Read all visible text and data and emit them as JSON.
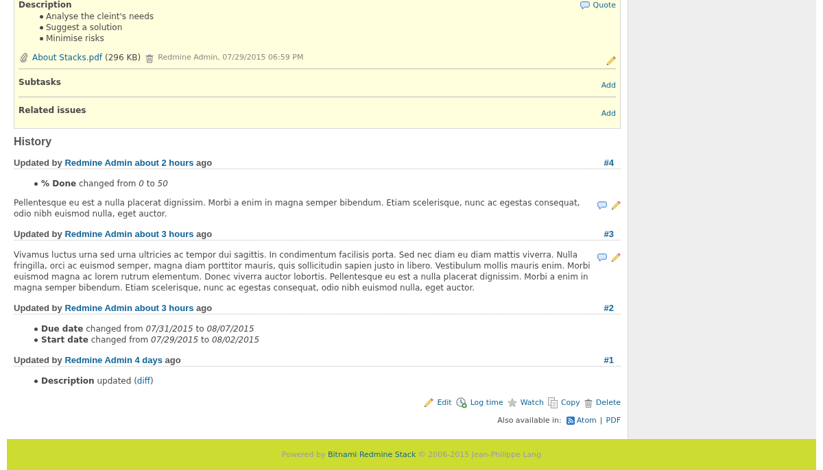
{
  "issue": {
    "description": {
      "label": "Description",
      "quote_link": "Quote",
      "items": [
        "Analyse the cleint's needs",
        "Suggest a solution",
        "Minimise risks"
      ]
    },
    "attachments": [
      {
        "name": "About Stacks.pdf",
        "size": "(296 KB)",
        "author_date": "Redmine Admin, 07/29/2015 06:59 PM"
      }
    ],
    "sections": [
      {
        "title": "Subtasks",
        "action": "Add"
      },
      {
        "title": "Related issues",
        "action": "Add"
      }
    ]
  },
  "history": {
    "title": "History",
    "journals": [
      {
        "prefix": "Updated by",
        "author": "Redmine Admin",
        "time": "about 2 hours",
        "suffix": "ago",
        "number": "#4",
        "details": [
          {
            "text": "**% Done** changed from *0* to *50*"
          }
        ],
        "notes": "Pellentesque eu est a nulla placerat dignissim. Morbi a enim in magna semper bibendum. Etiam scelerisque, nunc ac egestas consequat, odio nibh euismod nulla, eget auctor."
      },
      {
        "prefix": "Updated by",
        "author": "Redmine Admin",
        "time": "about 3 hours",
        "suffix": "ago",
        "number": "#3",
        "notes": "Vivamus luctus urna sed urna ultricies ac tempor dui sagittis. In condimentum facilisis porta. Sed nec diam eu diam mattis viverra. Nulla fringilla, orci ac euismod semper, magna diam porttitor mauris, quis sollicitudin sapien justo in libero. Vestibulum mollis mauris enim. Morbi euismod magna ac lorem rutrum elementum. Donec viverra auctor lobortis. Pellentesque eu est a nulla placerat dignissim. Morbi a enim in magna semper bibendum. Etiam scelerisque, nunc ac egestas consequat, odio nibh euismod nulla, eget auctor."
      },
      {
        "prefix": "Updated by",
        "author": "Redmine Admin",
        "time": "about 3 hours",
        "suffix": "ago",
        "number": "#2",
        "details": [
          {
            "text": "**Due date** changed from *07/31/2015* to *08/07/2015*"
          },
          {
            "text": "**Start date** changed from *07/29/2015* to *08/02/2015*"
          }
        ]
      },
      {
        "prefix": "Updated by",
        "author": "Redmine Admin",
        "time": "4 days",
        "suffix": "ago",
        "number": "#1",
        "details": [
          {
            "text": "**Description** updated (",
            "link": "diff",
            "after": ")"
          }
        ]
      }
    ]
  },
  "actions": [
    {
      "kind": "edit",
      "label": "Edit"
    },
    {
      "kind": "log_time",
      "label": "Log time"
    },
    {
      "kind": "watch",
      "label": "Watch"
    },
    {
      "kind": "copy",
      "label": "Copy"
    },
    {
      "kind": "delete",
      "label": "Delete"
    }
  ],
  "formats": {
    "label": "Also available in:",
    "links": [
      {
        "kind": "atom",
        "label": "Atom"
      },
      {
        "kind": "pdf",
        "label": "PDF"
      }
    ],
    "separator": "|"
  },
  "footer": {
    "prefix": "Powered by",
    "link": "Bitnami Redmine Stack",
    "suffix": "© 2006-2015 Jean-Philippe Lang"
  }
}
